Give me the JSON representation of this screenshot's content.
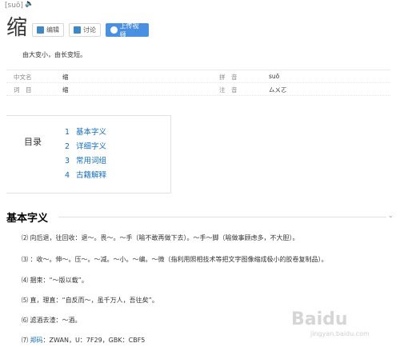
{
  "header": {
    "pinyin": "[suō]",
    "speaker_icon": "speaker-icon",
    "headword": "缩",
    "buttons": {
      "edit": "编辑",
      "discuss": "讨论",
      "upload": "上传视频"
    }
  },
  "summary": "由大变小，由长变短。",
  "info": {
    "row1": {
      "k1": "中文名",
      "v1": "缩",
      "k2": "拼　音",
      "v2": "suō"
    },
    "row2": {
      "k1": "词　目",
      "v1": "缩",
      "k2": "注　音",
      "v2": "ㄙㄨㄛ"
    }
  },
  "toc": {
    "title": "目录",
    "items": [
      {
        "num": "1",
        "label": "基本字义"
      },
      {
        "num": "2",
        "label": "详细字义"
      },
      {
        "num": "3",
        "label": "常用词组"
      },
      {
        "num": "4",
        "label": "古籍解释"
      }
    ]
  },
  "section": {
    "title": "基本字义",
    "definitions": [
      "⑵ 向后退，往回收：退～。畏～。～手（喻不敢再做下去）。～手～脚（喻做事顾虑多，不大胆）。",
      "⑶ ：收～。伸～。压～。～减。～小。～编。～微（指利用照相技术等把文字图像缩成极小的胶卷复制品）。",
      "⑷ 捆束：“～版以载”。",
      "⑸ 直，理直：“自反而～，虽千万人，吾往矣”。",
      "⑹ 滤酒去渣：～酒。"
    ],
    "last_prefix": "⑺ ",
    "last_link": "郑码",
    "last_rest": "：ZWAN，U：7F29，GBK：CBF5"
  },
  "watermark": {
    "brand": "Baidu",
    "sub": "jingyan.baidu.com"
  }
}
